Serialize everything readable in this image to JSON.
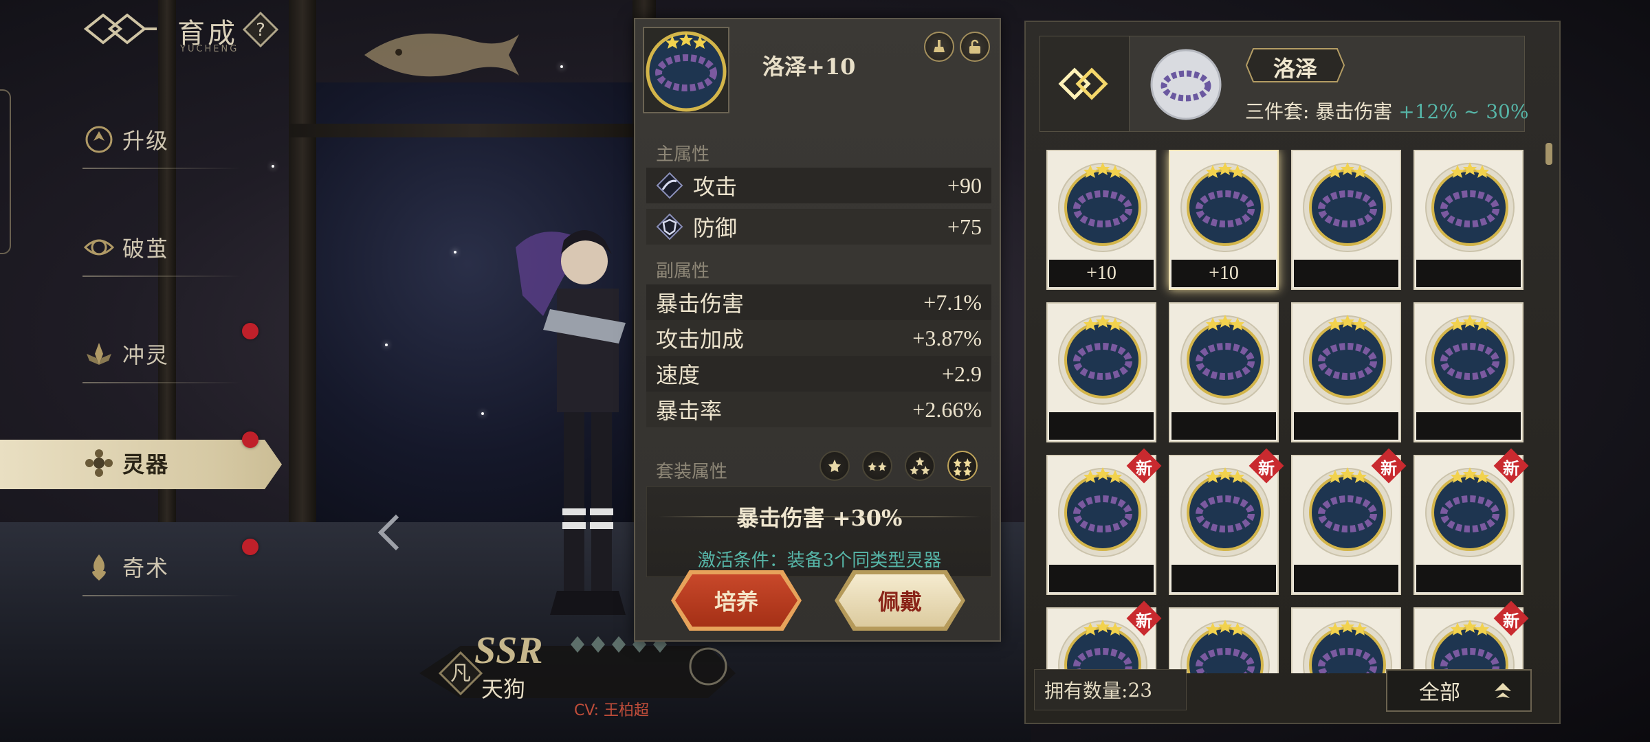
{
  "nav": {
    "title": "育成",
    "subtitle": "YUCHENG",
    "help_label": "?",
    "items": [
      {
        "label": "升级"
      },
      {
        "label": "破茧"
      },
      {
        "label": "冲灵"
      },
      {
        "label": "灵器",
        "active": true
      },
      {
        "label": "奇术"
      }
    ]
  },
  "character": {
    "rarity": "SSR",
    "element_glyph": "凡",
    "name": "天狗",
    "cv": "CV: 王柏超"
  },
  "detail": {
    "item_name": "洛泽+10",
    "main_title": "主属性",
    "main_stats": [
      {
        "label": "攻击",
        "value": "+90",
        "icon": "attack-icon"
      },
      {
        "label": "防御",
        "value": "+75",
        "icon": "defense-icon"
      }
    ],
    "sub_title": "副属性",
    "sub_stats": [
      {
        "label": "暴击伤害",
        "value": "+7.1%"
      },
      {
        "label": "攻击加成",
        "value": "+3.87%"
      },
      {
        "label": "速度",
        "value": "+2.9"
      },
      {
        "label": "暴击率",
        "value": "+2.66%"
      }
    ],
    "set_title": "套装属性",
    "set_effect": "暴击伤害 +30%",
    "set_condition": "激活条件：装备3个同类型灵器",
    "cultivate_label": "培养",
    "equip_label": "佩戴"
  },
  "inventory": {
    "set_name": "洛泽",
    "set_desc_prefix": "三件套: 暴击伤害 ",
    "set_desc_range": "+12% ~ 30%",
    "items": [
      {
        "label": "+10",
        "new": false,
        "selected": false
      },
      {
        "label": "+10",
        "new": false,
        "selected": true
      },
      {
        "label": "",
        "new": false,
        "selected": false
      },
      {
        "label": "",
        "new": false,
        "selected": false
      },
      {
        "label": "",
        "new": false,
        "selected": false
      },
      {
        "label": "",
        "new": false,
        "selected": false
      },
      {
        "label": "",
        "new": false,
        "selected": false
      },
      {
        "label": "",
        "new": false,
        "selected": false
      },
      {
        "label": "",
        "new": true,
        "selected": false
      },
      {
        "label": "",
        "new": true,
        "selected": false
      },
      {
        "label": "",
        "new": true,
        "selected": false
      },
      {
        "label": "",
        "new": true,
        "selected": false
      },
      {
        "label": "",
        "new": true,
        "selected": false
      },
      {
        "label": "",
        "new": false,
        "selected": false
      },
      {
        "label": "",
        "new": false,
        "selected": false
      },
      {
        "label": "",
        "new": true,
        "selected": false
      }
    ],
    "new_label": "新",
    "count_label": "拥有数量: ",
    "count_value": "23",
    "filter_label": "全部"
  },
  "colors": {
    "accent_teal": "#56b5a7",
    "badge_red": "#c92a2f",
    "button_red": "#b43a1e",
    "button_gold": "#e8dcb6"
  }
}
